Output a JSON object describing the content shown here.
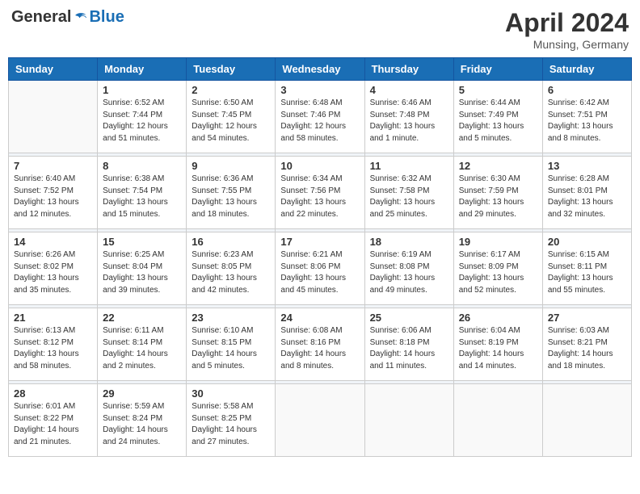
{
  "header": {
    "logo_general": "General",
    "logo_blue": "Blue",
    "month_title": "April 2024",
    "subtitle": "Munsing, Germany"
  },
  "days_of_week": [
    "Sunday",
    "Monday",
    "Tuesday",
    "Wednesday",
    "Thursday",
    "Friday",
    "Saturday"
  ],
  "weeks": [
    [
      {
        "day": "",
        "content": ""
      },
      {
        "day": "1",
        "content": "Sunrise: 6:52 AM\nSunset: 7:44 PM\nDaylight: 12 hours\nand 51 minutes."
      },
      {
        "day": "2",
        "content": "Sunrise: 6:50 AM\nSunset: 7:45 PM\nDaylight: 12 hours\nand 54 minutes."
      },
      {
        "day": "3",
        "content": "Sunrise: 6:48 AM\nSunset: 7:46 PM\nDaylight: 12 hours\nand 58 minutes."
      },
      {
        "day": "4",
        "content": "Sunrise: 6:46 AM\nSunset: 7:48 PM\nDaylight: 13 hours\nand 1 minute."
      },
      {
        "day": "5",
        "content": "Sunrise: 6:44 AM\nSunset: 7:49 PM\nDaylight: 13 hours\nand 5 minutes."
      },
      {
        "day": "6",
        "content": "Sunrise: 6:42 AM\nSunset: 7:51 PM\nDaylight: 13 hours\nand 8 minutes."
      }
    ],
    [
      {
        "day": "7",
        "content": "Sunrise: 6:40 AM\nSunset: 7:52 PM\nDaylight: 13 hours\nand 12 minutes."
      },
      {
        "day": "8",
        "content": "Sunrise: 6:38 AM\nSunset: 7:54 PM\nDaylight: 13 hours\nand 15 minutes."
      },
      {
        "day": "9",
        "content": "Sunrise: 6:36 AM\nSunset: 7:55 PM\nDaylight: 13 hours\nand 18 minutes."
      },
      {
        "day": "10",
        "content": "Sunrise: 6:34 AM\nSunset: 7:56 PM\nDaylight: 13 hours\nand 22 minutes."
      },
      {
        "day": "11",
        "content": "Sunrise: 6:32 AM\nSunset: 7:58 PM\nDaylight: 13 hours\nand 25 minutes."
      },
      {
        "day": "12",
        "content": "Sunrise: 6:30 AM\nSunset: 7:59 PM\nDaylight: 13 hours\nand 29 minutes."
      },
      {
        "day": "13",
        "content": "Sunrise: 6:28 AM\nSunset: 8:01 PM\nDaylight: 13 hours\nand 32 minutes."
      }
    ],
    [
      {
        "day": "14",
        "content": "Sunrise: 6:26 AM\nSunset: 8:02 PM\nDaylight: 13 hours\nand 35 minutes."
      },
      {
        "day": "15",
        "content": "Sunrise: 6:25 AM\nSunset: 8:04 PM\nDaylight: 13 hours\nand 39 minutes."
      },
      {
        "day": "16",
        "content": "Sunrise: 6:23 AM\nSunset: 8:05 PM\nDaylight: 13 hours\nand 42 minutes."
      },
      {
        "day": "17",
        "content": "Sunrise: 6:21 AM\nSunset: 8:06 PM\nDaylight: 13 hours\nand 45 minutes."
      },
      {
        "day": "18",
        "content": "Sunrise: 6:19 AM\nSunset: 8:08 PM\nDaylight: 13 hours\nand 49 minutes."
      },
      {
        "day": "19",
        "content": "Sunrise: 6:17 AM\nSunset: 8:09 PM\nDaylight: 13 hours\nand 52 minutes."
      },
      {
        "day": "20",
        "content": "Sunrise: 6:15 AM\nSunset: 8:11 PM\nDaylight: 13 hours\nand 55 minutes."
      }
    ],
    [
      {
        "day": "21",
        "content": "Sunrise: 6:13 AM\nSunset: 8:12 PM\nDaylight: 13 hours\nand 58 minutes."
      },
      {
        "day": "22",
        "content": "Sunrise: 6:11 AM\nSunset: 8:14 PM\nDaylight: 14 hours\nand 2 minutes."
      },
      {
        "day": "23",
        "content": "Sunrise: 6:10 AM\nSunset: 8:15 PM\nDaylight: 14 hours\nand 5 minutes."
      },
      {
        "day": "24",
        "content": "Sunrise: 6:08 AM\nSunset: 8:16 PM\nDaylight: 14 hours\nand 8 minutes."
      },
      {
        "day": "25",
        "content": "Sunrise: 6:06 AM\nSunset: 8:18 PM\nDaylight: 14 hours\nand 11 minutes."
      },
      {
        "day": "26",
        "content": "Sunrise: 6:04 AM\nSunset: 8:19 PM\nDaylight: 14 hours\nand 14 minutes."
      },
      {
        "day": "27",
        "content": "Sunrise: 6:03 AM\nSunset: 8:21 PM\nDaylight: 14 hours\nand 18 minutes."
      }
    ],
    [
      {
        "day": "28",
        "content": "Sunrise: 6:01 AM\nSunset: 8:22 PM\nDaylight: 14 hours\nand 21 minutes."
      },
      {
        "day": "29",
        "content": "Sunrise: 5:59 AM\nSunset: 8:24 PM\nDaylight: 14 hours\nand 24 minutes."
      },
      {
        "day": "30",
        "content": "Sunrise: 5:58 AM\nSunset: 8:25 PM\nDaylight: 14 hours\nand 27 minutes."
      },
      {
        "day": "",
        "content": ""
      },
      {
        "day": "",
        "content": ""
      },
      {
        "day": "",
        "content": ""
      },
      {
        "day": "",
        "content": ""
      }
    ]
  ]
}
